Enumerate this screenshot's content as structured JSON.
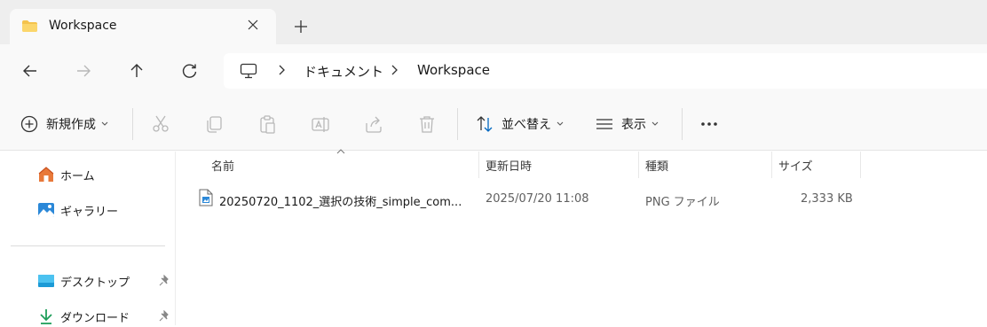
{
  "window": {
    "tab_title": "Workspace",
    "tab_close_icon": "close-icon",
    "new_tab_icon": "plus-icon"
  },
  "nav": {
    "back_icon": "arrow-left-icon",
    "forward_icon": "arrow-right-icon",
    "up_icon": "arrow-up-icon",
    "refresh_icon": "refresh-icon"
  },
  "breadcrumb": {
    "root_icon": "this-pc-icon",
    "items": [
      "ドキュメント",
      "Workspace"
    ]
  },
  "toolbar": {
    "new_label": "新規作成",
    "sort_label": "並べ替え",
    "view_label": "表示",
    "more_icon": "more-icon",
    "disabled_icons": [
      "cut-icon",
      "copy-icon",
      "paste-icon",
      "rename-icon",
      "share-icon",
      "delete-icon"
    ]
  },
  "sidebar": {
    "items": [
      {
        "label": "ホーム",
        "icon": "home-icon"
      },
      {
        "label": "ギャラリー",
        "icon": "gallery-icon"
      },
      {
        "label": "デスクトップ",
        "icon": "desktop-icon",
        "pinned": true
      },
      {
        "label": "ダウンロード",
        "icon": "download-icon",
        "pinned": true
      }
    ]
  },
  "columns": {
    "name": "名前",
    "modified": "更新日時",
    "type": "種類",
    "size": "サイズ"
  },
  "files": [
    {
      "name": "20250720_1102_選択の技術_simple_com...",
      "modified": "2025/07/20 11:08",
      "type": "PNG ファイル",
      "size": "2,333 KB",
      "icon": "png-file-icon"
    }
  ],
  "colors": {
    "accent": "#0067c0",
    "folder": "#f4c34d",
    "disabled": "#b8b8b8"
  }
}
